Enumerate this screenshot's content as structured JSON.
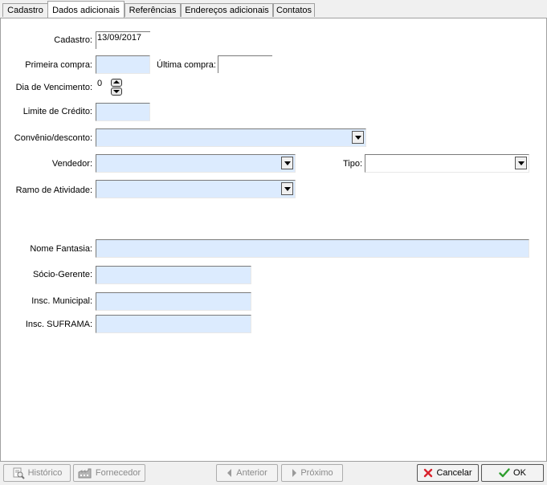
{
  "tabs": [
    {
      "label": "Cadastro"
    },
    {
      "label": "Dados adicionais"
    },
    {
      "label": "Referências"
    },
    {
      "label": "Endereços adicionais"
    },
    {
      "label": "Contatos"
    }
  ],
  "form": {
    "cadastro": {
      "label": "Cadastro:",
      "value": "13/09/2017"
    },
    "primeira_compra": {
      "label": "Primeira compra:",
      "value": ""
    },
    "ultima_compra": {
      "label": "Última compra:",
      "value": ""
    },
    "dia_vencimento": {
      "label": "Dia de Vencimento:",
      "value": "0"
    },
    "limite_credito": {
      "label": "Limite de Crédito:",
      "value": ""
    },
    "convenio": {
      "label": "Convênio/desconto:",
      "value": ""
    },
    "vendedor": {
      "label": "Vendedor:",
      "value": ""
    },
    "tipo": {
      "label": "Tipo:",
      "value": ""
    },
    "ramo_atividade": {
      "label": "Ramo de Atividade:",
      "value": ""
    },
    "nome_fantasia": {
      "label": "Nome Fantasia:",
      "value": ""
    },
    "socio_gerente": {
      "label": "Sócio-Gerente:",
      "value": ""
    },
    "insc_municipal": {
      "label": "Insc. Municipal:",
      "value": ""
    },
    "insc_suframa": {
      "label": "Insc. SUFRAMA:",
      "value": ""
    }
  },
  "buttons": {
    "historico": "Histórico",
    "fornecedor": "Fornecedor",
    "anterior": "Anterior",
    "proximo": "Próximo",
    "cancelar": "Cancelar",
    "ok": "OK"
  },
  "colors": {
    "input_bg": "#dcebfe",
    "cancel_icon": "#d9232d",
    "ok_icon": "#2e9e2e"
  }
}
